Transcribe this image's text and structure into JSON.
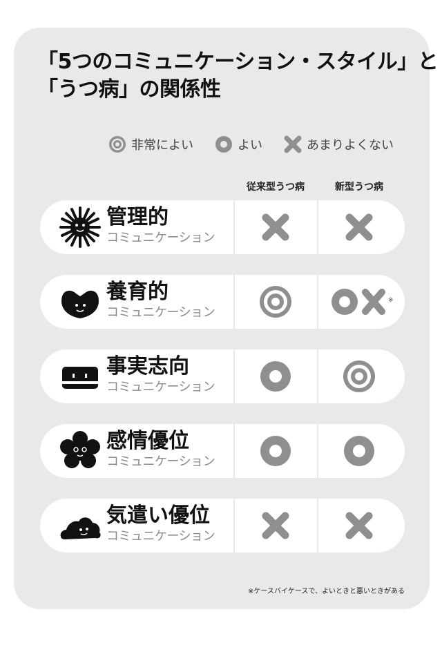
{
  "title": {
    "line1": "「5つのコミュニケーション・スタイル」と",
    "line2": "「うつ病」の関係性"
  },
  "legend": [
    {
      "symbol": "double-circle",
      "label": "非常によい"
    },
    {
      "symbol": "circle",
      "label": "よい"
    },
    {
      "symbol": "cross",
      "label": "あまりよくない"
    }
  ],
  "columns": [
    "従来型うつ病",
    "新型うつ病"
  ],
  "rows": [
    {
      "name": "管理的",
      "sub": "コミュニケーション",
      "icon": "spiky-sun-icon",
      "traditional": "cross",
      "new": "cross"
    },
    {
      "name": "養育的",
      "sub": "コミュニケーション",
      "icon": "heart-face-icon",
      "traditional": "double-circle",
      "new": "circle-cross"
    },
    {
      "name": "事実志向",
      "sub": "コミュニケーション",
      "icon": "box-face-icon",
      "traditional": "circle",
      "new": "double-circle"
    },
    {
      "name": "感情優位",
      "sub": "コミュニケーション",
      "icon": "flower-face-icon",
      "traditional": "circle",
      "new": "circle"
    },
    {
      "name": "気遣い優位",
      "sub": "コミュニケーション",
      "icon": "cloud-face-icon",
      "traditional": "cross",
      "new": "cross"
    }
  ],
  "note_mark": "※",
  "footnote": "※ケースバイケースで、よいときと悪いときがある",
  "colors": {
    "symbol": "#8f8f8f",
    "card": "#e9e9e9",
    "row": "#ffffff",
    "text": "#111111"
  }
}
